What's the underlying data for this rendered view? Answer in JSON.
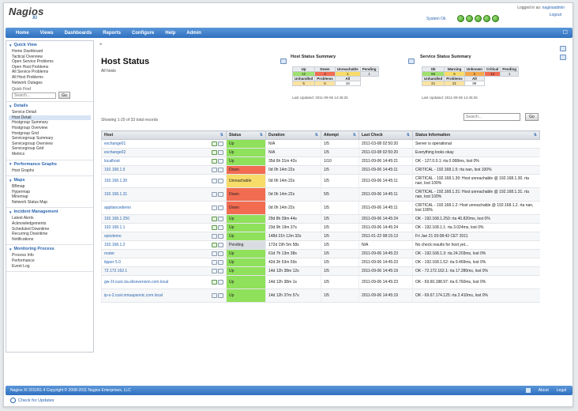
{
  "header": {
    "logo": "Nagios",
    "logo_sub": "XI",
    "logged_in_prefix": "Logged in as:",
    "logged_in_user": "nagiosadmin",
    "logout": "Logout",
    "system_status": "System Ok"
  },
  "nav": {
    "items": [
      "Home",
      "Views",
      "Dashboards",
      "Reports",
      "Configure",
      "Help",
      "Admin"
    ]
  },
  "sidebar": {
    "sections": [
      {
        "title": "Quick View",
        "links": [
          "Home Dashboard",
          "Tactical Overview",
          "Open Service Problems",
          "Open Host Problems",
          "All Service Problems",
          "All Host Problems",
          "Network Outages"
        ]
      },
      {
        "title": "Details",
        "links": [
          "Service Detail",
          "Host Detail",
          "Hostgroup Summary",
          "Hostgroup Overview",
          "Hostgroup Grid",
          "Servicegroup Summary",
          "Servicegroup Overview",
          "Servicegroup Grid",
          "Metrics"
        ]
      },
      {
        "title": "Performance Graphs",
        "links": [
          "Host Graphs"
        ]
      },
      {
        "title": "Maps",
        "links": [
          "BBmap",
          "Hypermap",
          "Minemap",
          "Network Status Map"
        ]
      },
      {
        "title": "Incident Management",
        "links": [
          "Latest Alerts",
          "Acknowledgements",
          "Scheduled Downtime",
          "Recurring Downtime",
          "Notifications"
        ]
      },
      {
        "title": "Monitoring Process",
        "links": [
          "Process Info",
          "Performance",
          "Event Log"
        ]
      }
    ],
    "quick_find_label": "Quick Find",
    "quick_find_placeholder": "Search...",
    "go": "Go"
  },
  "main": {
    "title": "Host Status",
    "subtitle": "All hosts",
    "showing": "Showing 1-20 of 33 total records",
    "search_placeholder": "Search...",
    "go": "Go"
  },
  "host_summary": {
    "title": "Host Status Summary",
    "headers": [
      "Up",
      "Down",
      "Unreachable",
      "Pending"
    ],
    "values": [
      "12",
      "4",
      "1",
      "1"
    ],
    "headers2": [
      "Unhandled",
      "Problems",
      "All"
    ],
    "values2": [
      "5",
      "5",
      "18"
    ],
    "updated": "Last Updated: 2011-09-06 14:45:25"
  },
  "service_summary": {
    "title": "Service Status Summary",
    "headers": [
      "Ok",
      "Warning",
      "Unknown",
      "Critical",
      "Pending"
    ],
    "values": [
      "66",
      "6",
      "2",
      "13",
      "1"
    ],
    "headers2": [
      "Unhandled",
      "Problems",
      "All"
    ],
    "values2": [
      "21",
      "21",
      "88"
    ],
    "updated": "Last Updated: 2011-09-06 14:45:25"
  },
  "table": {
    "headers": [
      "Host",
      "Status",
      "Duration",
      "Attempt",
      "Last Check",
      "Status Information"
    ],
    "rows": [
      {
        "host": "exchange01",
        "status": "Up",
        "cls": "st-up",
        "duration": "N/A",
        "attempt": "1/5",
        "last": "2011-03-08 02:50:20",
        "info": "Server is operational",
        "tall": false
      },
      {
        "host": "exchange02",
        "status": "Up",
        "cls": "st-up",
        "duration": "N/A",
        "attempt": "1/5",
        "last": "2011-03-08 02:50:20",
        "info": "Everything looks okay",
        "tall": false
      },
      {
        "host": "localhost",
        "status": "Up",
        "cls": "st-up",
        "duration": "35d 6h 31m 42s",
        "attempt": "1/10",
        "last": "2011-09-06 14:45:21",
        "info": "OK - 127.0.0.1: rta 0.068ms, lost 0%",
        "tall": false
      },
      {
        "host": "192.168.1.5",
        "status": "Down",
        "cls": "st-down",
        "duration": "0d 0h 14m 22s",
        "attempt": "1/5",
        "last": "2011-09-06 14:45:11",
        "info": "CRITICAL - 192.168.1.5: rta nan, lost 100%",
        "tall": false
      },
      {
        "host": "192.168.1.30",
        "status": "Unreachable",
        "cls": "st-unr",
        "duration": "0d 0h 14m 22s",
        "attempt": "1/5",
        "last": "2011-09-06 14:45:11",
        "info": "CRITICAL - 192.168.1.30: Host unreachable @ 192.168.1.30. rta nan, lost 100%",
        "tall": true
      },
      {
        "host": "192.168.1.31",
        "status": "Down",
        "cls": "st-down",
        "duration": "0d 0h 14m 22s",
        "attempt": "5/5",
        "last": "2011-09-06 14:45:11",
        "info": "CRITICAL - 192.168.1.31: Host unreachable @ 192.168.1.31. rta nan, lost 100%",
        "tall": true
      },
      {
        "host": "appliancedemo",
        "status": "Down",
        "cls": "st-down",
        "duration": "0d 0h 14m 22s",
        "attempt": "1/5",
        "last": "2011-09-06 14:45:11",
        "info": "CRITICAL - 192.168.1.2: Host unreachable @ 192.168.1.2. rta nan, lost 100%",
        "tall": true
      },
      {
        "host": "192.168.1.250",
        "status": "Up",
        "cls": "st-up",
        "duration": "29d 8h 39m 44s",
        "attempt": "1/5",
        "last": "2011-09-06 14:45:24",
        "info": "OK - 192.168.1.250: rta 40.820ms, lost 0%",
        "tall": false
      },
      {
        "host": "192.168.1.1",
        "status": "Up",
        "cls": "st-up",
        "duration": "23d 9h 19m 37s",
        "attempt": "1/5",
        "last": "2011-09-06 14:45:24",
        "info": "OK - 192.168.1.1: rta 3.024ms, lost 0%",
        "tall": false
      },
      {
        "host": "epicdemo",
        "status": "Up",
        "cls": "st-up",
        "duration": "148d 21h 12m 32s",
        "attempt": "1/5",
        "last": "2011-01-22 08:15:13",
        "info": "Fri Jan 21 03:08:43 CET 2011",
        "tall": false
      },
      {
        "host": "192.168.1.2",
        "status": "Pending",
        "cls": "st-pend",
        "duration": "172d 19h 5m 58s",
        "attempt": "1/5",
        "last": "N/A",
        "info": "No check results for host yet...",
        "tall": false
      },
      {
        "host": "router",
        "status": "Up",
        "cls": "st-up",
        "duration": "61d 7h 13m 38s",
        "attempt": "1/5",
        "last": "2011-09-06 14:45:23",
        "info": "OK - 192.168.1.3: rta 24.203ms, lost 0%",
        "tall": false
      },
      {
        "host": "tipper 5.0",
        "status": "Up",
        "cls": "st-up",
        "duration": "42d 3h 53m 59s",
        "attempt": "1/5",
        "last": "2011-09-06 14:45:23",
        "info": "OK - 192.168.1.52: rta 9.469ms, lost 0%",
        "tall": false
      },
      {
        "host": "72.172.162.1",
        "status": "Up",
        "cls": "st-up",
        "duration": "14d 12h 38m 12s",
        "attempt": "1/5",
        "last": "2011-09-06 14:45:19",
        "info": "OK - 72.172.162.1: rta 17.280ms, lost 0%",
        "tall": false
      },
      {
        "host": "gw-1f-cust.cia.elixeversion.com.local",
        "status": "Up",
        "cls": "st-up",
        "duration": "14d 12h 38m 1s",
        "attempt": "1/5",
        "last": "2011-09-06 14:45:23",
        "info": "OK - 69.60.188.97: rta 6.760ms, lost 0%",
        "tall": true
      },
      {
        "host": "ip-s-2.cust.nmuapsonic.com.local",
        "status": "Up",
        "cls": "st-up",
        "duration": "14d 12h 37m 57s",
        "attempt": "1/5",
        "last": "2011-09-06 14:45:19",
        "info": "OK - 69.67.174.125: rta 2.410ms, lost 0%",
        "tall": true
      }
    ]
  },
  "footer": {
    "copyright": "Nagios XI 2011R1.4 Copyright © 2008-2011 Nagios Enterprises, LLC",
    "about": "About",
    "legal": "Legal",
    "updates": "Check for Updates"
  },
  "colors": {
    "nav": "#3c7fcd",
    "up": "#8fe05a",
    "down": "#f26c52",
    "unreachable": "#f7dc6a",
    "pending": "#d9dde2"
  }
}
